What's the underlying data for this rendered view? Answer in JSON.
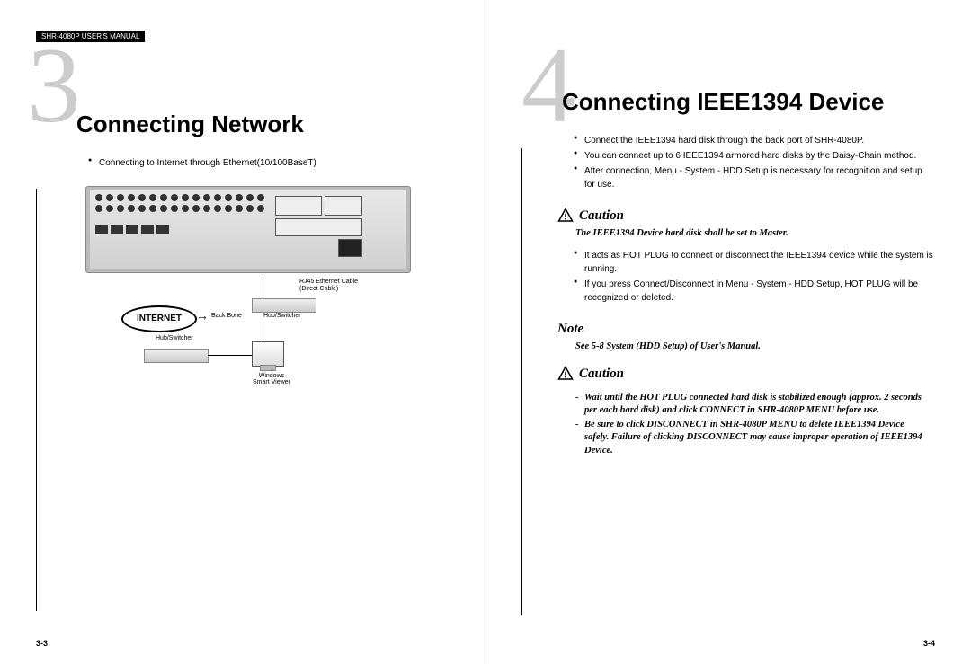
{
  "header": "SHR-4080P USER'S MANUAL",
  "left": {
    "number": "3",
    "title": "Connecting Network",
    "bullets": [
      "Connecting to Internet through Ethernet(10/100BaseT)"
    ],
    "diagram": {
      "internet_label": "INTERNET",
      "backbone_label": "Back Bone",
      "hub_label": "Hub/Switcher",
      "rj45_label_line1": "RJ45 Ethernet Cable",
      "rj45_label_line2": "(Direct Cable)",
      "viewer_label_line1": "Windows",
      "viewer_label_line2": "Smart Viewer"
    },
    "page_num": "3-3"
  },
  "right": {
    "number": "4",
    "title": "Connecting IEEE1394 Device",
    "bullets": [
      "Connect the IEEE1394 hard disk through the back port of SHR-4080P.",
      "You can connect up to 6 IEEE1394 armored hard disks by the Daisy-Chain method.",
      "After connection, Menu - System - HDD Setup is necessary for recognition and setup for use."
    ],
    "caution1_label": "Caution",
    "caution1_text": "The IEEE1394 Device hard disk shall be set to Master.",
    "bullets2": [
      "It acts as HOT PLUG to connect or disconnect the IEEE1394 device while the system is running.",
      "If you press Connect/Disconnect in Menu - System - HDD Setup, HOT PLUG will be recognized or deleted."
    ],
    "note_label": "Note",
    "note_text": "See 5-8 System (HDD Setup) of User's Manual.",
    "caution2_label": "Caution",
    "caution2_items": [
      "Wait until the HOT PLUG connected hard disk is stabilized enough (approx. 2 seconds per each hard disk) and click CONNECT in SHR-4080P MENU before use.",
      "Be sure to click DISCONNECT in SHR-4080P MENU to delete IEEE1394 Device safely. Failure of clicking DISCONNECT may cause improper operation of IEEE1394 Device."
    ],
    "page_num": "3-4"
  }
}
